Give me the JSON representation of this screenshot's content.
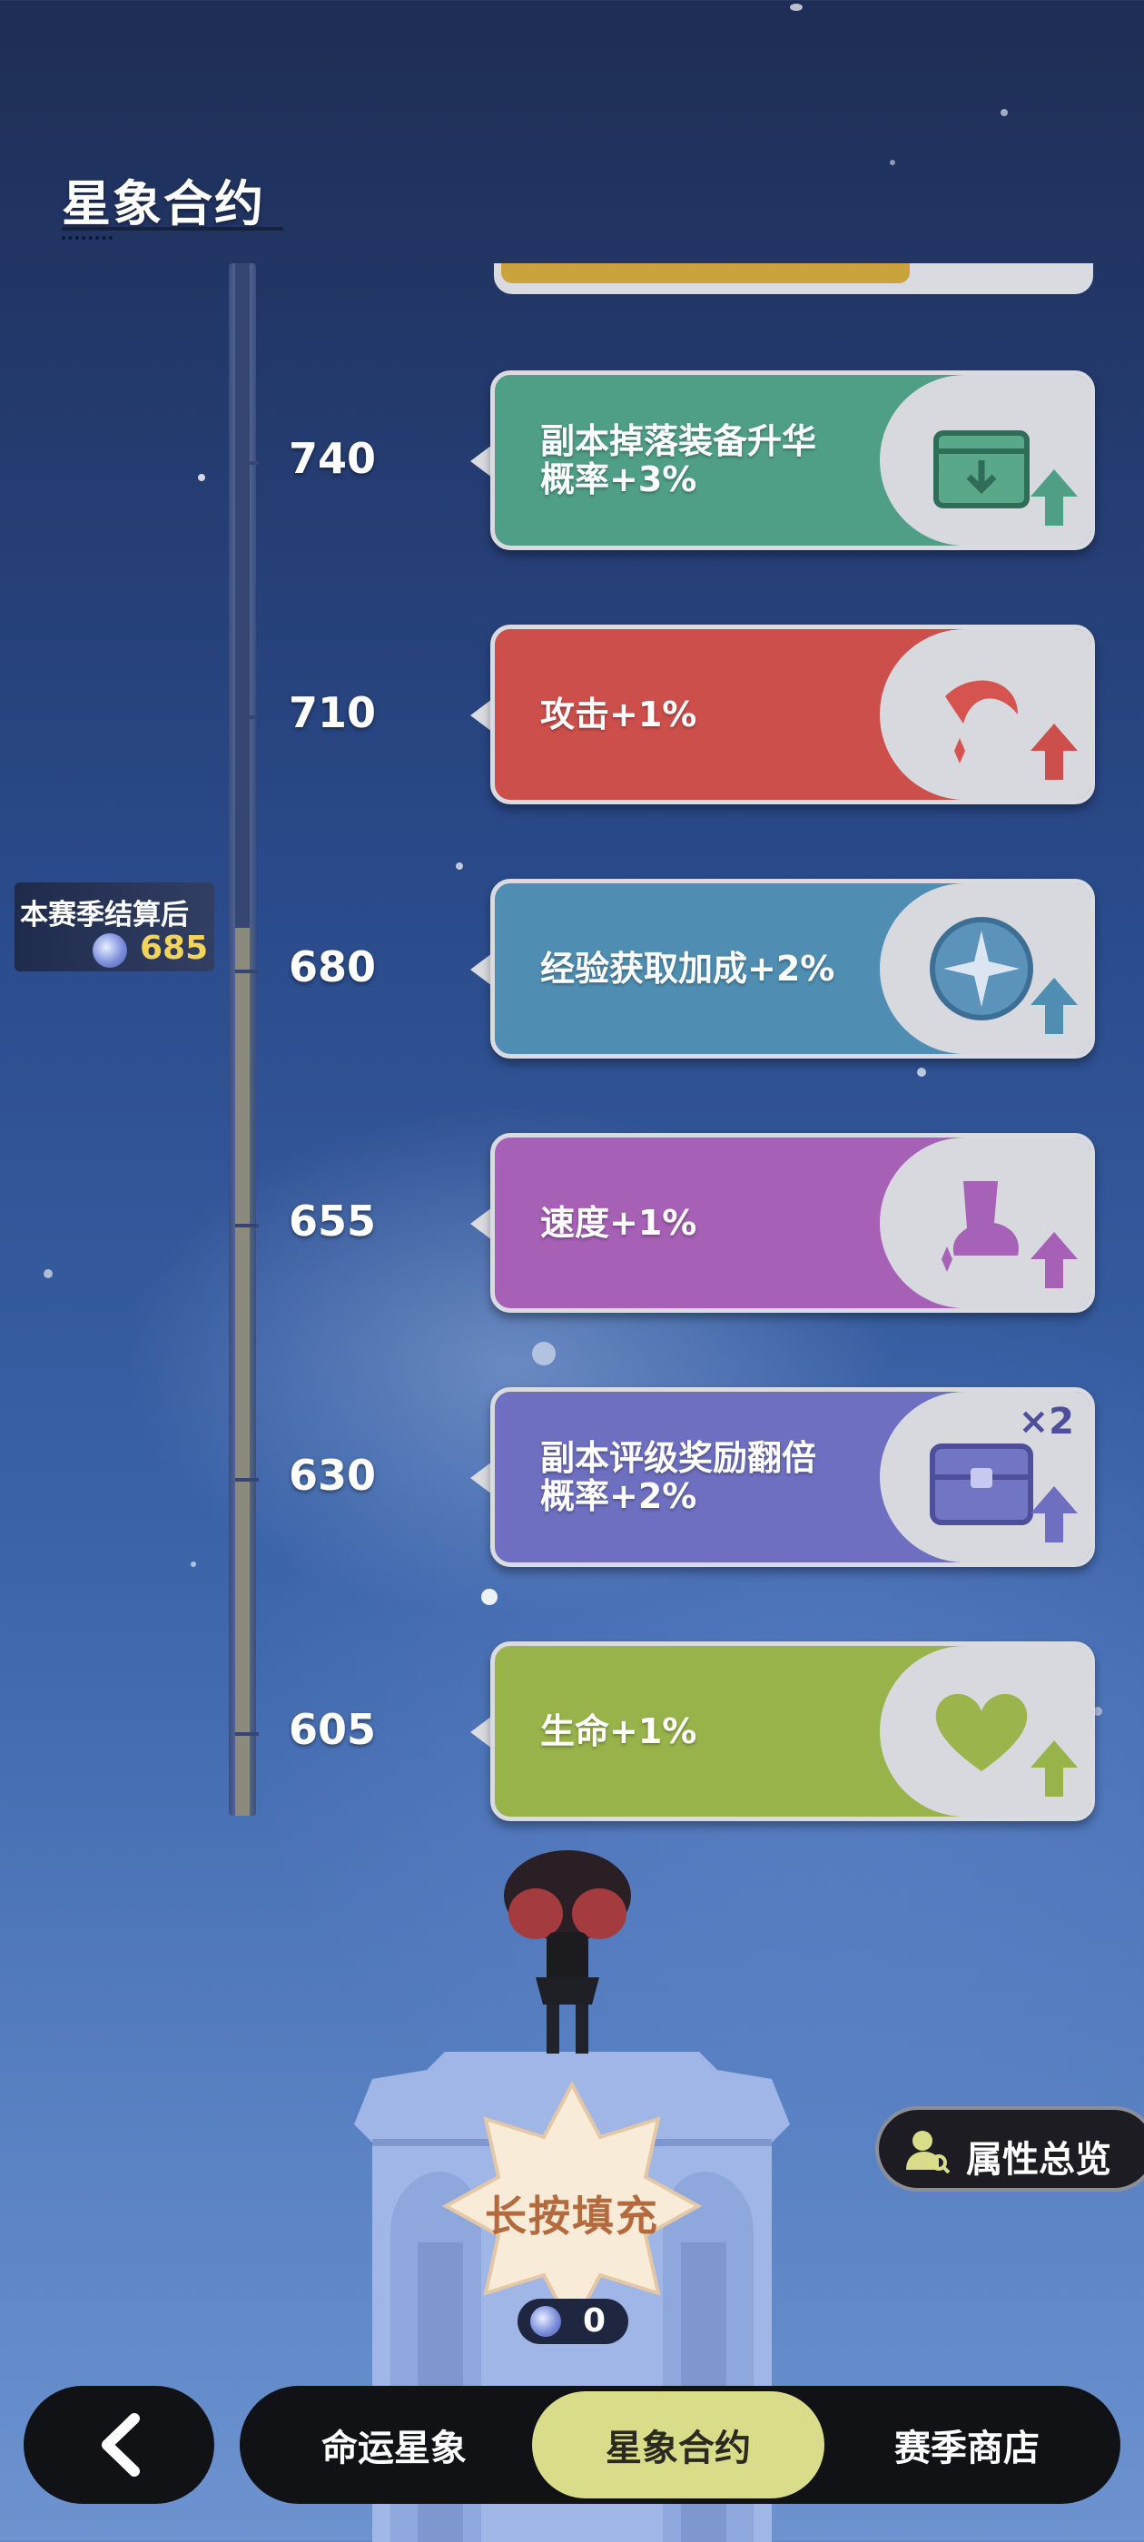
{
  "header": {
    "title": "星象合约"
  },
  "season_marker": {
    "label": "本赛季结算后",
    "value": "685",
    "icon": "star-orb-icon"
  },
  "tiers": [
    {
      "level": "740",
      "text_lines": [
        "副本掉落装备升华",
        "概率+3%"
      ],
      "color": "#4f9f86",
      "icon": "equipment-box-icon"
    },
    {
      "level": "710",
      "text_lines": [
        "攻击+1%"
      ],
      "color": "#cd4f4c",
      "icon": "attack-slash-icon"
    },
    {
      "level": "680",
      "text_lines": [
        "经验获取加成+2%"
      ],
      "color": "#4f8eb2",
      "icon": "exp-compass-icon"
    },
    {
      "level": "655",
      "text_lines": [
        "速度+1%"
      ],
      "color": "#a660b6",
      "icon": "speed-boot-icon"
    },
    {
      "level": "630",
      "text_lines": [
        "副本评级奖励翻倍",
        "概率+2%"
      ],
      "color": "#6e6fc0",
      "icon": "reward-chest-icon",
      "badge": "×2"
    },
    {
      "level": "605",
      "text_lines": [
        "生命+1%"
      ],
      "color": "#98b34a",
      "icon": "heart-icon"
    }
  ],
  "fill_button": {
    "label": "长按填充",
    "count": "0"
  },
  "overview_button": {
    "label": "属性总览",
    "icon": "user-search-icon"
  },
  "bottom_nav": {
    "back_icon": "chevron-left-icon",
    "tabs": [
      {
        "label": "命运星象",
        "active": false
      },
      {
        "label": "星象合约",
        "active": true
      },
      {
        "label": "赛季商店",
        "active": false
      }
    ]
  },
  "colors": {
    "accent_active_tab": "#d9dd8a",
    "progress_fill": "#8c8a7c",
    "season_value": "#f2d35b"
  }
}
